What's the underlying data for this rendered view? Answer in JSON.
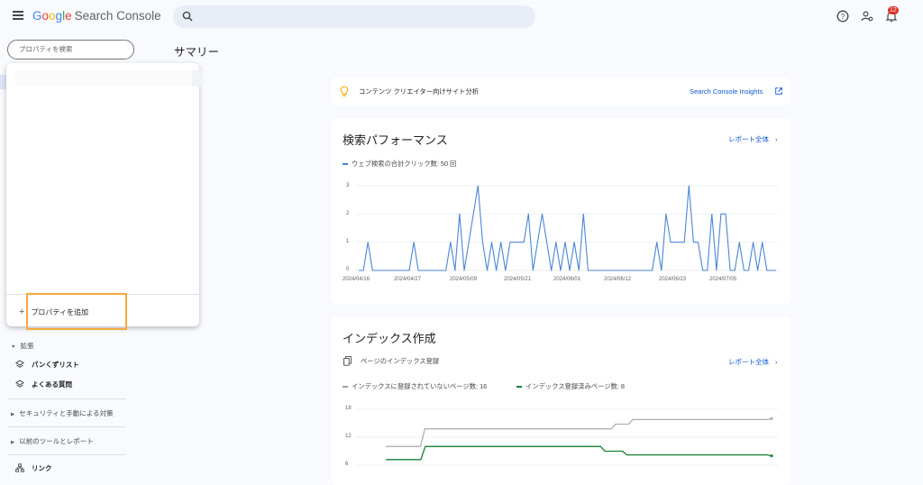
{
  "header": {
    "logo_google": [
      "G",
      "o",
      "o",
      "g",
      "l",
      "e"
    ],
    "logo_product": "Search Console",
    "notification_count": "12",
    "icons": [
      "menu-icon",
      "search-icon",
      "help-icon",
      "account-settings-icon",
      "notifications-icon"
    ]
  },
  "property_selector": {
    "placeholder": "プロパティを検索",
    "add_label": "プロパティを追加"
  },
  "page": {
    "title": "サマリー"
  },
  "sidebar": {
    "section_extensions": "拡張",
    "items": [
      {
        "label": "パンくずリスト",
        "icon": "layers-icon"
      },
      {
        "label": "よくある質問",
        "icon": "layers-icon"
      }
    ],
    "section_security": "セキュリティと手動による対策",
    "section_legacy": "以前のツールとレポート",
    "links_item": {
      "label": "リンク",
      "icon": "sitemap-icon"
    }
  },
  "insights": {
    "text": "コンテンツ クリエイター向けサイト分析",
    "link": "Search Console Insights",
    "icon": "lightbulb-icon"
  },
  "performance": {
    "title": "検索パフォーマンス",
    "full_report": "レポート全体",
    "chart_data": {
      "type": "line",
      "series": [
        {
          "name": "ウェブ検索の合計クリック数: 50 回",
          "color": "#4a86d6",
          "values": [
            0,
            0,
            1,
            0,
            0,
            0,
            0,
            0,
            0,
            0,
            0,
            0,
            1,
            0,
            0,
            0,
            0,
            0,
            0,
            0,
            1,
            0,
            2,
            0,
            1,
            2,
            3,
            1,
            0,
            1,
            0,
            1,
            0,
            1,
            1,
            1,
            1,
            2,
            0,
            1,
            2,
            1,
            0,
            1,
            0,
            1,
            0,
            1,
            0,
            2,
            0,
            0,
            0,
            0,
            0,
            0,
            0,
            0,
            0,
            0,
            0,
            0,
            0,
            0,
            0,
            1,
            0,
            2,
            1,
            1,
            1,
            1,
            3,
            1,
            1,
            0,
            0,
            2,
            0,
            2,
            2,
            0,
            0,
            1,
            0,
            0,
            1,
            0,
            1,
            0,
            0,
            0
          ]
        }
      ],
      "x_tick_labels": [
        "2024/04/16",
        "2024/04/27",
        "2024/05/09",
        "2024/05/21",
        "2024/06/01",
        "2024/06/12",
        "2024/06/23",
        "2024/07/05"
      ],
      "y_tick_labels": [
        "0",
        "1",
        "2",
        "3"
      ],
      "ylim": [
        0,
        3
      ],
      "grid": true
    }
  },
  "indexing": {
    "title": "インデックス作成",
    "subtitle": "ページのインデックス登録",
    "subtitle_icon": "copy-pages-icon",
    "full_report": "レポート全体",
    "chart_data": {
      "type": "line",
      "series": [
        {
          "name": "インデックスに登録されていないページ数: 16",
          "color": "#b0b0b0",
          "values": [
            10,
            10,
            10,
            10,
            10,
            10,
            10,
            10,
            10,
            13.8,
            13.8,
            13.8,
            13.8,
            13.8,
            13.8,
            13.8,
            13.8,
            13.8,
            13.8,
            13.8,
            13.8,
            13.8,
            13.8,
            13.8,
            13.8,
            13.8,
            13.8,
            13.8,
            13.8,
            13.8,
            13.8,
            13.8,
            13.8,
            13.8,
            13.8,
            13.8,
            13.8,
            13.8,
            13.8,
            13.8,
            13.8,
            13.8,
            13.8,
            13.8,
            13.8,
            13.8,
            13.8,
            13.8,
            13.8,
            13.8,
            13.8,
            13.8,
            13.8,
            14.8,
            14.8,
            14.8,
            14.8,
            15.8,
            15.8,
            15.8,
            15.8,
            15.8,
            15.8,
            15.8,
            15.8,
            15.8,
            15.8,
            15.8,
            15.8,
            15.8,
            15.8,
            15.8,
            15.8,
            15.8,
            15.8,
            15.8,
            15.8,
            15.8,
            15.8,
            15.8,
            15.8,
            15.8,
            15.8,
            15.8,
            15.8,
            15.8,
            15.8,
            15.8,
            15.8,
            16
          ]
        },
        {
          "name": "インデックス登録済みページ数: 8",
          "color": "#188038",
          "values": [
            7.2,
            7.2,
            7.2,
            7.2,
            7.2,
            7.2,
            7.2,
            7.2,
            7.2,
            10,
            10,
            10,
            10,
            10,
            10,
            10,
            10,
            10,
            10,
            10,
            10,
            10,
            10,
            10,
            10,
            10,
            10,
            10,
            10,
            10,
            10,
            10,
            10,
            10,
            10,
            10,
            10,
            10,
            10,
            10,
            10,
            10,
            10,
            10,
            10,
            10,
            10,
            10,
            10,
            10,
            9,
            9,
            9,
            9,
            9,
            8.2,
            8.2,
            8.2,
            8.2,
            8.2,
            8.2,
            8.2,
            8.2,
            8.2,
            8.2,
            8.2,
            8.2,
            8.2,
            8.2,
            8.2,
            8.2,
            8.2,
            8.2,
            8.2,
            8.2,
            8.2,
            8.2,
            8.2,
            8.2,
            8.2,
            8.2,
            8.2,
            8.2,
            8.2,
            8.2,
            8.2,
            8.2,
            8.2,
            8
          ]
        }
      ],
      "y_tick_labels": [
        "6",
        "12",
        "18"
      ],
      "ylim": [
        6,
        18
      ],
      "grid": true
    }
  }
}
